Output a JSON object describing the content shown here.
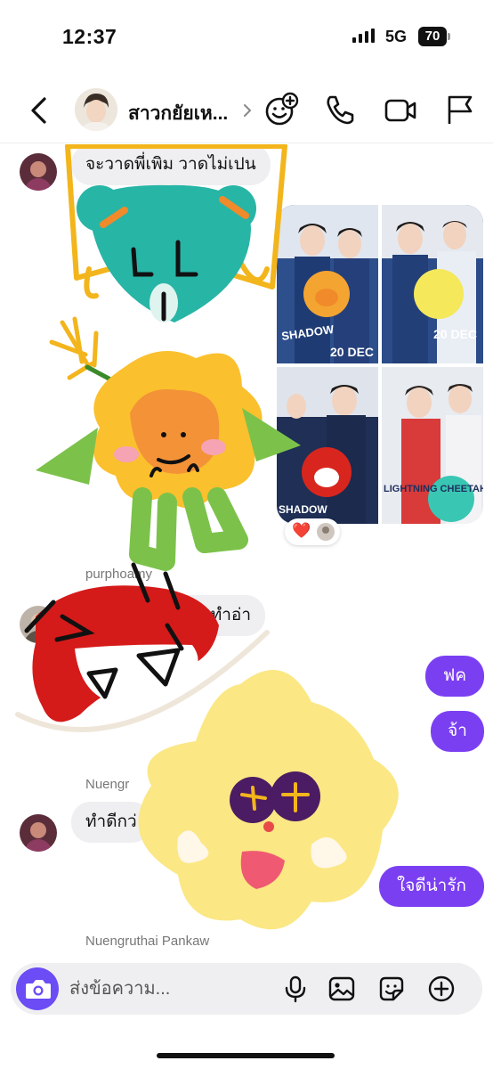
{
  "status": {
    "time": "12:37",
    "network": "5G",
    "battery": "70"
  },
  "header": {
    "contact_name": "สาวกยัยเห..."
  },
  "messages": {
    "m1_text": "จะวาดพี่เพิม วาดไม่เปน",
    "sender_1": "purphoamy",
    "m2_text": "ฟคทำอ่า",
    "out_1": "ฟค",
    "out_2": "จ้า",
    "sender_2": "Nuengr",
    "m3_text": "ทำดีกว่",
    "out_3": "ใจดีน่ารัก",
    "sender_3": "Nuengruthai Pankaw"
  },
  "photos": {
    "dates": [
      "20 DEC",
      "20 DEC"
    ],
    "teams": [
      "SHADOW EAGLE",
      "LIGHTNING CHEETAH"
    ]
  },
  "reactions": [
    "❤️"
  ],
  "composer": {
    "placeholder": "ส่งข้อความ..."
  },
  "icons": {
    "header": [
      "back-icon",
      "chevron-right-icon",
      "add-person-icon",
      "phone-icon",
      "video-icon",
      "flag-icon"
    ],
    "composer": [
      "camera-icon",
      "microphone-icon",
      "image-icon",
      "sticker-icon",
      "plus-icon"
    ]
  },
  "colors": {
    "accent": "#7b3ff2",
    "camera": "#6b4cf5",
    "bubble_in": "#efeff1"
  }
}
